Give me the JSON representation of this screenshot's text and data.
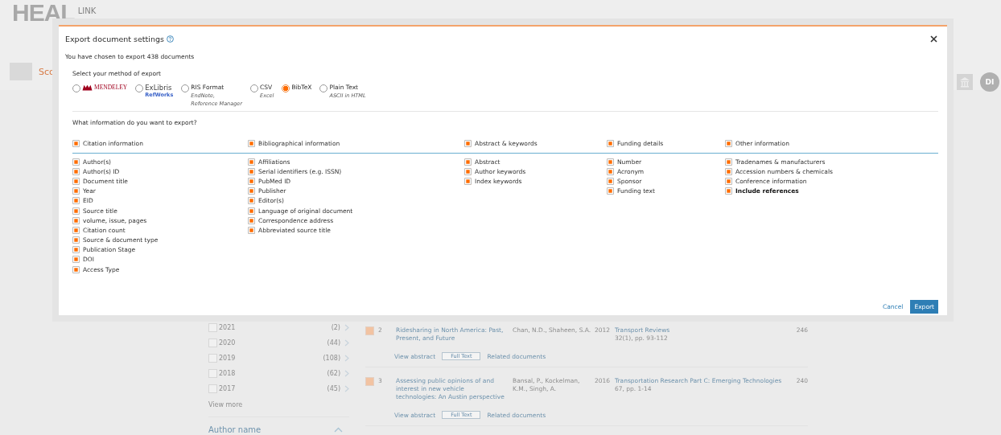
{
  "background": {
    "logo": {
      "text": "HEAL",
      "subtext": "LINK"
    },
    "app_name": "Sco",
    "avatar": "DI",
    "year_filters": [
      {
        "label": "2021",
        "count": "(2)",
        "checked": false
      },
      {
        "label": "2020",
        "count": "(44)",
        "checked": false
      },
      {
        "label": "2019",
        "count": "(108)",
        "checked": false
      },
      {
        "label": "2018",
        "count": "(62)",
        "checked": false
      },
      {
        "label": "2017",
        "count": "(45)",
        "checked": false
      }
    ],
    "view_more": "View more",
    "author_section": "Author name",
    "results": [
      {
        "number": "2",
        "checked": true,
        "title": "Ridesharing in North America: Past, Present, and Future",
        "authors": "Chan, N.D., Shaheen, S.A.",
        "year": "2012",
        "source": "Transport Reviews",
        "source_detail": "32(1), pp. 93-112",
        "citations": "246",
        "view_abstract": "View abstract",
        "full_text": "Full Text",
        "related": "Related documents"
      },
      {
        "number": "3",
        "checked": true,
        "title": "Assessing public opinions of and interest in new vehicle technologies: An Austin perspective",
        "authors": "Bansal, P., Kockelman, K.M., Singh, A.",
        "year": "2016",
        "source": "Transportation Research Part C: Emerging Technologies",
        "source_detail": "67, pp. 1-14",
        "citations": "240",
        "view_abstract": "View abstract",
        "full_text": "Full Text",
        "related": "Related documents"
      }
    ]
  },
  "modal": {
    "title": "Export document settings",
    "summary": "You have chosen to export 438 documents",
    "method_label": "Select your method of export",
    "methods": [
      {
        "kind": "mendeley",
        "label": "MENDELEY",
        "selected": false
      },
      {
        "kind": "exlibris",
        "label": "ExLibris",
        "sublabel": "RefWorks",
        "selected": false
      },
      {
        "kind": "text",
        "label": "RIS Format",
        "notes": [
          "EndNote,",
          "Reference Manager"
        ],
        "selected": false
      },
      {
        "kind": "text",
        "label": "CSV",
        "notes": [
          "Excel"
        ],
        "selected": false
      },
      {
        "kind": "text",
        "label": "BibTeX",
        "selected": true
      },
      {
        "kind": "text",
        "label": "Plain Text",
        "notes": [
          "ASCII in HTML"
        ],
        "selected": false
      }
    ],
    "info_question": "What information do you want to export?",
    "groups": [
      {
        "label": "Citation information",
        "checked": true,
        "items": [
          {
            "label": "Author(s)",
            "checked": true
          },
          {
            "label": "Author(s) ID",
            "checked": true
          },
          {
            "label": "Document title",
            "checked": true
          },
          {
            "label": "Year",
            "checked": true
          },
          {
            "label": "EID",
            "checked": true
          },
          {
            "label": "Source title",
            "checked": true
          },
          {
            "label": "volume, issue, pages",
            "checked": true
          },
          {
            "label": "Citation count",
            "checked": true
          },
          {
            "label": "Source & document type",
            "checked": true
          },
          {
            "label": "Publication Stage",
            "checked": true
          },
          {
            "label": "DOI",
            "checked": true
          },
          {
            "label": "Access Type",
            "checked": true
          }
        ]
      },
      {
        "label": "Bibliographical information",
        "checked": true,
        "items": [
          {
            "label": "Affiliations",
            "checked": true
          },
          {
            "label": "Serial identifiers (e.g. ISSN)",
            "checked": true
          },
          {
            "label": "PubMed ID",
            "checked": true
          },
          {
            "label": "Publisher",
            "checked": true
          },
          {
            "label": "Editor(s)",
            "checked": true
          },
          {
            "label": "Language of original document",
            "checked": true
          },
          {
            "label": "Correspondence address",
            "checked": true
          },
          {
            "label": "Abbreviated source title",
            "checked": true
          }
        ]
      },
      {
        "label": "Abstract & keywords",
        "checked": true,
        "items": [
          {
            "label": "Abstract",
            "checked": true
          },
          {
            "label": "Author keywords",
            "checked": true
          },
          {
            "label": "Index keywords",
            "checked": true
          }
        ]
      },
      {
        "label": "Funding details",
        "checked": true,
        "items": [
          {
            "label": "Number",
            "checked": true
          },
          {
            "label": "Acronym",
            "checked": true
          },
          {
            "label": "Sponsor",
            "checked": true
          },
          {
            "label": "Funding text",
            "checked": true
          }
        ]
      },
      {
        "label": "Other information",
        "checked": true,
        "items": [
          {
            "label": "Tradenames & manufacturers",
            "checked": true
          },
          {
            "label": "Accession numbers & chemicals",
            "checked": true
          },
          {
            "label": "Conference information",
            "checked": true
          },
          {
            "label": "Include references",
            "checked": true,
            "bold": true
          }
        ]
      }
    ],
    "cancel": "Cancel",
    "export": "Export"
  }
}
